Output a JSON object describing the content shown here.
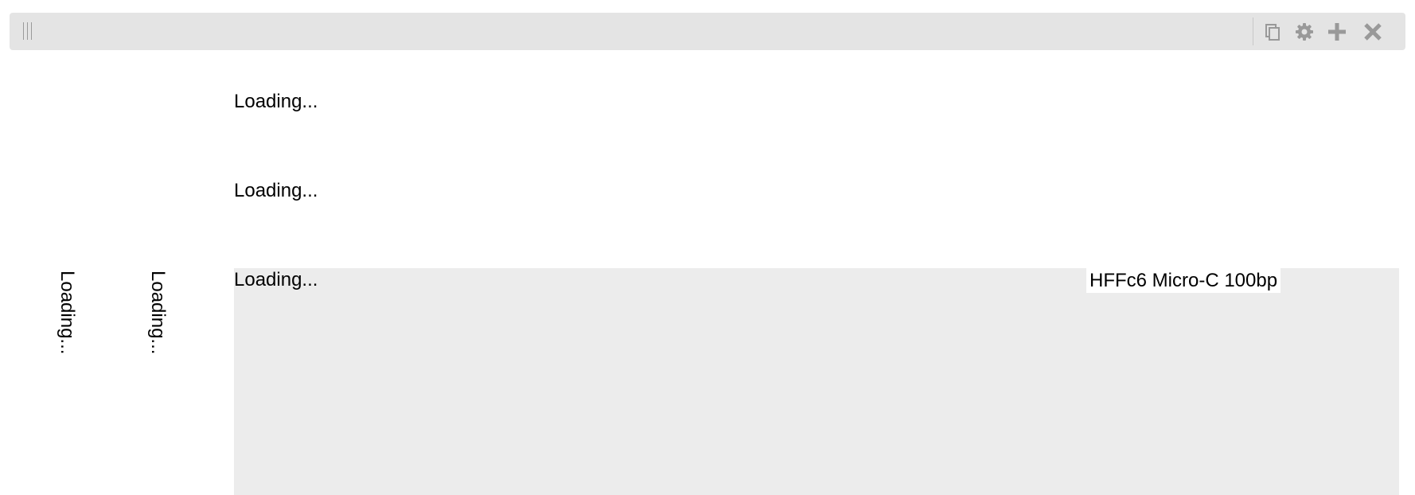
{
  "header": {
    "icons": [
      "duplicate-icon",
      "gear-icon",
      "plus-icon",
      "close-icon"
    ],
    "icon_color": "#999999",
    "bar_color": "#e4e4e4"
  },
  "tracks": {
    "top_1_loading": "Loading...",
    "top_2_loading": "Loading...",
    "center_loading": "Loading...",
    "center_track_name": "HFFc6 Micro-C 100bp",
    "left_1_loading": "Loading...",
    "left_2_loading": "Loading...",
    "center_bg_color": "#ececec"
  }
}
